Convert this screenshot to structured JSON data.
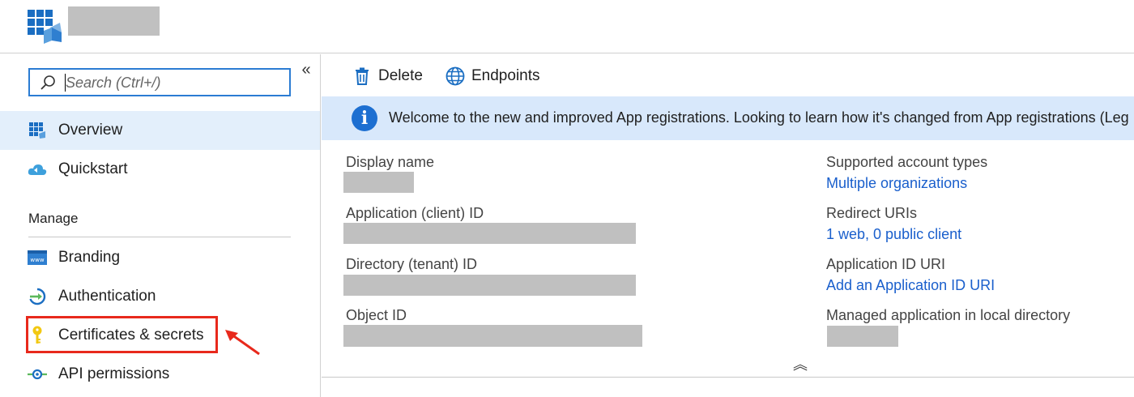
{
  "header": {
    "app_icon": "app-registrations-icon"
  },
  "sidebar": {
    "search": {
      "placeholder": "Search (Ctrl+/)",
      "value": ""
    },
    "collapse_label": "«",
    "items_top": [
      {
        "label": "Overview",
        "icon": "overview-grid-icon",
        "active": true
      },
      {
        "label": "Quickstart",
        "icon": "cloud-quickstart-icon",
        "active": false
      }
    ],
    "section_label": "Manage",
    "items_manage": [
      {
        "label": "Branding",
        "icon": "branding-www-icon"
      },
      {
        "label": "Authentication",
        "icon": "authentication-icon"
      },
      {
        "label": "Certificates & secrets",
        "icon": "key-icon",
        "highlighted": true
      },
      {
        "label": "API permissions",
        "icon": "api-permissions-icon"
      }
    ]
  },
  "toolbar": {
    "delete_label": "Delete",
    "endpoints_label": "Endpoints"
  },
  "banner": {
    "text": "Welcome to the new and improved App registrations. Looking to learn how it's changed from App registrations (Leg"
  },
  "essentials": {
    "left": [
      {
        "label": "Display name",
        "value": ""
      },
      {
        "label": "Application (client) ID",
        "value": ""
      },
      {
        "label": "Directory (tenant) ID",
        "value": ""
      },
      {
        "label": "Object ID",
        "value": ""
      }
    ],
    "right": [
      {
        "label": "Supported account types",
        "value": "Multiple organizations"
      },
      {
        "label": "Redirect URIs",
        "value": "1 web, 0 public client"
      },
      {
        "label": "Application ID URI",
        "value": "Add an Application ID URI"
      },
      {
        "label": "Managed application in local directory",
        "value": ""
      }
    ],
    "collapse_toggle": "︽"
  },
  "colors": {
    "accent": "#2b7cd3",
    "link": "#1a5fcc",
    "banner_bg": "#d8e8fb",
    "active_nav_bg": "#e3effb",
    "highlight": "#e8291c",
    "redaction": "#c0c0c0"
  }
}
